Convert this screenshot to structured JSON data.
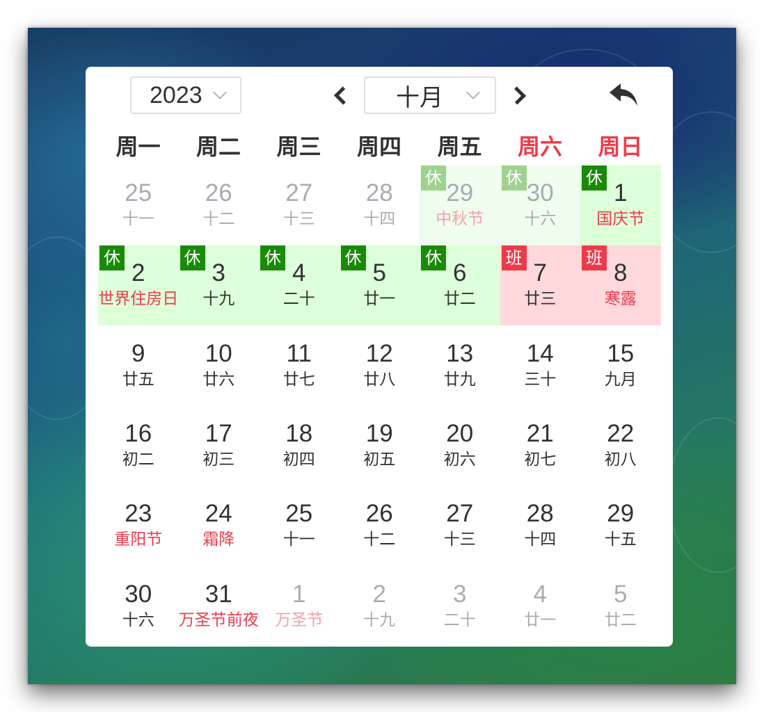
{
  "header": {
    "year": "2023",
    "month": "十月"
  },
  "weekdays": [
    "周一",
    "周二",
    "周三",
    "周四",
    "周五",
    "周六",
    "周日"
  ],
  "badge_labels": {
    "rest": "休",
    "work": "班"
  },
  "colors": {
    "rest_badge": "#1a8a0a",
    "work_badge": "#f03a4a",
    "rest_bg": "#ddffd9",
    "work_bg": "#ffd8dc",
    "weekend_text": "#f03a4a"
  },
  "days": [
    {
      "num": "25",
      "sub": "十一",
      "other": true
    },
    {
      "num": "26",
      "sub": "十二",
      "other": true
    },
    {
      "num": "27",
      "sub": "十三",
      "other": true
    },
    {
      "num": "28",
      "sub": "十四",
      "other": true
    },
    {
      "num": "29",
      "sub": "中秋节",
      "other": true,
      "red": true,
      "badge": "rest"
    },
    {
      "num": "30",
      "sub": "十六",
      "other": true,
      "badge": "rest"
    },
    {
      "num": "1",
      "sub": "国庆节",
      "red": true,
      "badge": "rest"
    },
    {
      "num": "2",
      "sub": "世界住房日",
      "red": true,
      "badge": "rest"
    },
    {
      "num": "3",
      "sub": "十九",
      "badge": "rest"
    },
    {
      "num": "4",
      "sub": "二十",
      "badge": "rest"
    },
    {
      "num": "5",
      "sub": "廿一",
      "badge": "rest"
    },
    {
      "num": "6",
      "sub": "廿二",
      "badge": "rest"
    },
    {
      "num": "7",
      "sub": "廿三",
      "badge": "work"
    },
    {
      "num": "8",
      "sub": "寒露",
      "red": true,
      "badge": "work"
    },
    {
      "num": "9",
      "sub": "廿五"
    },
    {
      "num": "10",
      "sub": "廿六"
    },
    {
      "num": "11",
      "sub": "廿七"
    },
    {
      "num": "12",
      "sub": "廿八"
    },
    {
      "num": "13",
      "sub": "廿九"
    },
    {
      "num": "14",
      "sub": "三十"
    },
    {
      "num": "15",
      "sub": "九月"
    },
    {
      "num": "16",
      "sub": "初二"
    },
    {
      "num": "17",
      "sub": "初三"
    },
    {
      "num": "18",
      "sub": "初四"
    },
    {
      "num": "19",
      "sub": "初五"
    },
    {
      "num": "20",
      "sub": "初六"
    },
    {
      "num": "21",
      "sub": "初七"
    },
    {
      "num": "22",
      "sub": "初八"
    },
    {
      "num": "23",
      "sub": "重阳节",
      "red": true
    },
    {
      "num": "24",
      "sub": "霜降",
      "red": true
    },
    {
      "num": "25",
      "sub": "十一"
    },
    {
      "num": "26",
      "sub": "十二"
    },
    {
      "num": "27",
      "sub": "十三"
    },
    {
      "num": "28",
      "sub": "十四"
    },
    {
      "num": "29",
      "sub": "十五"
    },
    {
      "num": "30",
      "sub": "十六"
    },
    {
      "num": "31",
      "sub": "万圣节前夜",
      "red": true
    },
    {
      "num": "1",
      "sub": "万圣节",
      "other": true,
      "red": true
    },
    {
      "num": "2",
      "sub": "十九",
      "other": true
    },
    {
      "num": "3",
      "sub": "二十",
      "other": true
    },
    {
      "num": "4",
      "sub": "廿一",
      "other": true
    },
    {
      "num": "5",
      "sub": "廿二",
      "other": true
    }
  ]
}
